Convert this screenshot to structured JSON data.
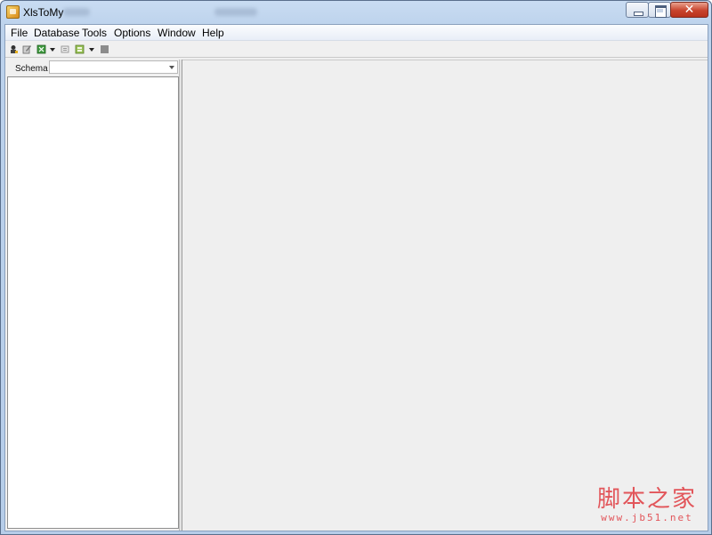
{
  "window": {
    "title": "XlsToMy",
    "close_glyph": "✕"
  },
  "menu": {
    "items": [
      "File",
      "Database",
      "Tools",
      "Options",
      "Window",
      "Help"
    ]
  },
  "toolbar": {
    "icons": [
      "connect-icon",
      "edit-connection-icon",
      "import-excel-icon",
      "import-dropdown-icon",
      "query-icon",
      "table-icon",
      "table-dropdown-icon",
      "stop-icon"
    ]
  },
  "left_panel": {
    "schema_label": "Schema",
    "schema_value": ""
  },
  "watermark": {
    "cn": "脚本之家",
    "url": "www.jb51.net"
  },
  "colors": {
    "titlebar": "#bcd2ec",
    "close_button": "#c8432c",
    "client_bg": "#f0f0f0",
    "watermark": "#e2555a"
  }
}
